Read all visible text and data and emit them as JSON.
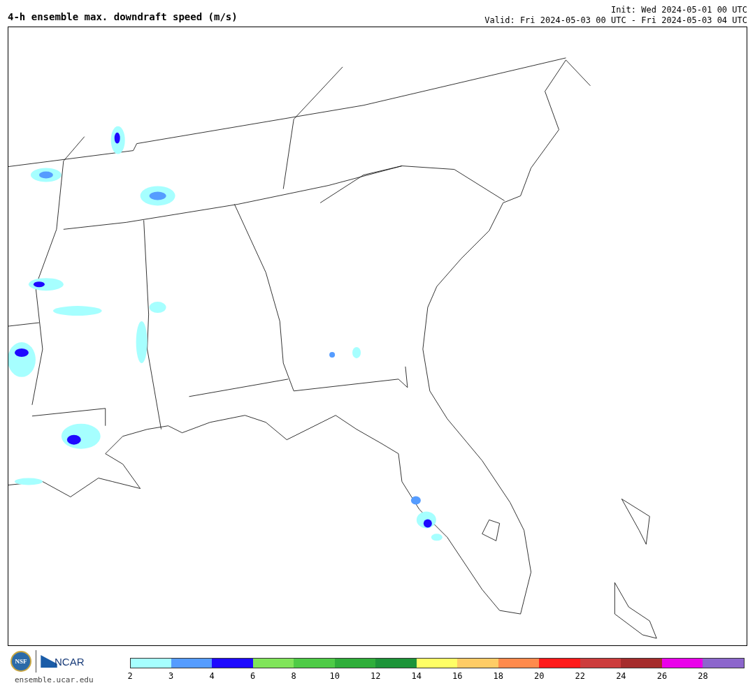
{
  "title": "4-h ensemble max. downdraft speed (m/s)",
  "init": "Init: Wed 2024-05-01 00 UTC",
  "valid": "Valid: Fri 2024-05-03 00 UTC - Fri 2024-05-03 04 UTC",
  "logos": {
    "nsf": "NSF",
    "ncar": "NCAR",
    "site": "ensemble.ucar.edu"
  },
  "colorbar": {
    "bins": [
      {
        "label": "2",
        "color": "#a6ffff"
      },
      {
        "label": "3",
        "color": "#559cff"
      },
      {
        "label": "4",
        "color": "#1e0aff"
      },
      {
        "label": "6",
        "color": "#80e45a"
      },
      {
        "label": "8",
        "color": "#4ecb46"
      },
      {
        "label": "10",
        "color": "#2fae3a"
      },
      {
        "label": "12",
        "color": "#1d9439"
      },
      {
        "label": "14",
        "color": "#ffff66"
      },
      {
        "label": "16",
        "color": "#ffcc66"
      },
      {
        "label": "18",
        "color": "#ff8a4c"
      },
      {
        "label": "20",
        "color": "#ff1a1a"
      },
      {
        "label": "22",
        "color": "#cc3c3c"
      },
      {
        "label": "24",
        "color": "#a52c2c"
      },
      {
        "label": "26",
        "color": "#ea00ea"
      },
      {
        "label": "28",
        "color": "#8c66cc"
      }
    ]
  }
}
